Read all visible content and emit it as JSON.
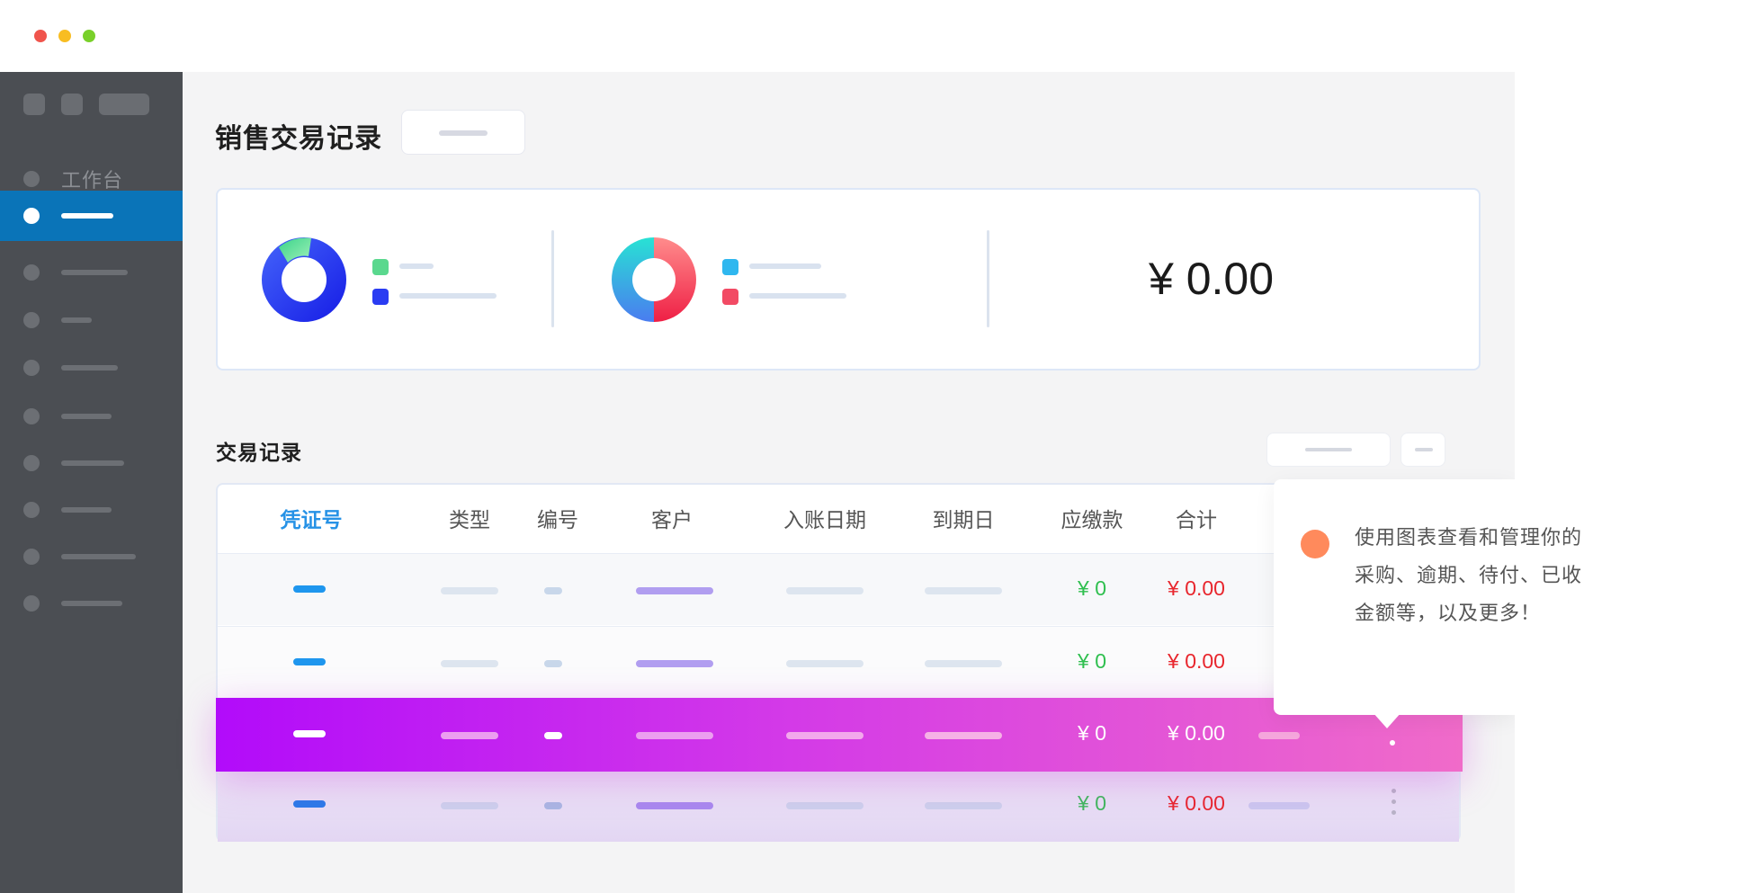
{
  "window": {
    "traffic_lights": [
      {
        "name": "close",
        "color": "#f0544c"
      },
      {
        "name": "minimize",
        "color": "#f8bd22"
      },
      {
        "name": "maximize",
        "color": "#79d02a"
      }
    ]
  },
  "sidebar": {
    "workbench_label": "工作台",
    "active_color": "#0a74b8"
  },
  "header": {
    "title": "销售交易记录"
  },
  "summary": {
    "donut1": {
      "colors": [
        "#1e3bf0",
        "#6fe3a0"
      ]
    },
    "donut2": {
      "colors": [
        "#3dd9e8",
        "#f2425a"
      ]
    },
    "legend1_colors": [
      "#5ad88e",
      "#2a3cf2"
    ],
    "legend2_colors": [
      "#2fb7ef",
      "#f24a64"
    ],
    "total": "¥ 0.00"
  },
  "transactions": {
    "section_title": "交易记录",
    "columns": [
      "凭证号",
      "类型",
      "编号",
      "客户",
      "入账日期",
      "到期日",
      "应缴款",
      "合计"
    ],
    "rows": [
      {
        "due": "¥ 0",
        "total": "¥ 0.00"
      },
      {
        "due": "¥ 0",
        "total": "¥ 0.00"
      },
      {
        "due": "¥ 0",
        "total": "¥ 0.00"
      },
      {
        "due": "¥ 0",
        "total": "¥ 0.00"
      }
    ],
    "colors": {
      "due": "#2fbf4f",
      "total": "#e8262d",
      "highlight_start": "#b20bfa",
      "highlight_end": "#f06bc9"
    }
  },
  "tooltip": {
    "line1": "使用图表查看和管理你的",
    "line2": "采购、逾期、待付、已收",
    "line3": "金额等，以及更多！",
    "accent": "#ff8a5c"
  }
}
